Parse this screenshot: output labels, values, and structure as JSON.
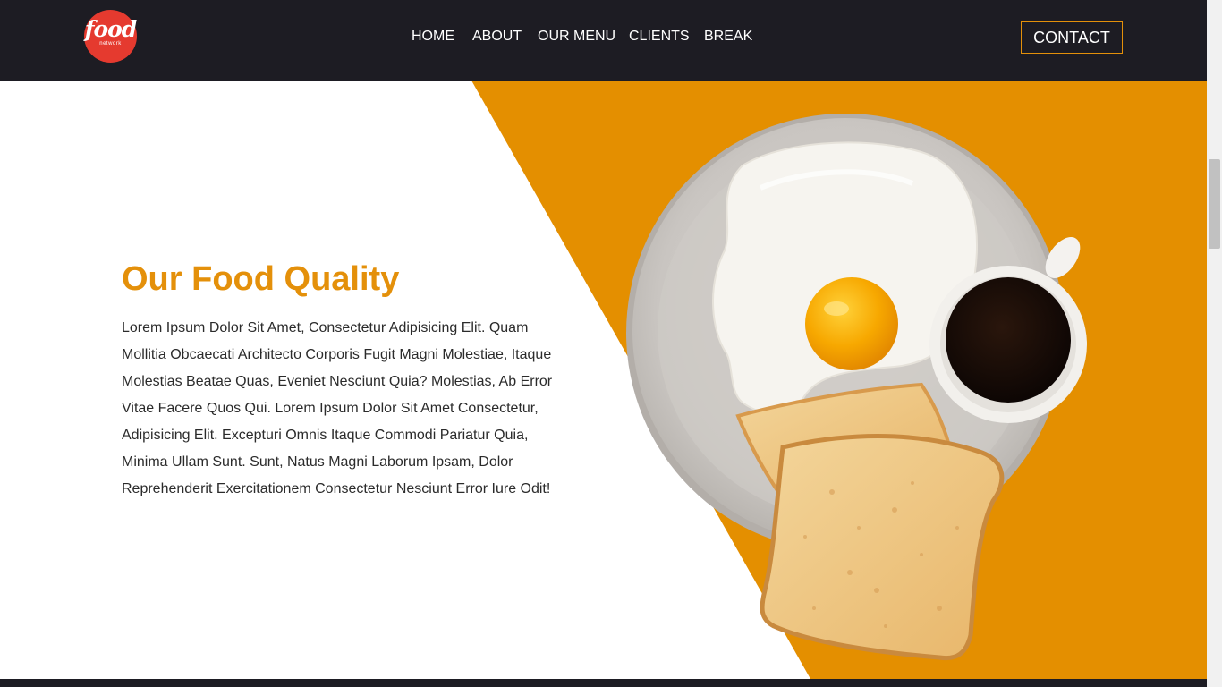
{
  "nav": {
    "logo_word": "food",
    "logo_sub": "network",
    "links": [
      "HOME",
      "ABOUT",
      "OUR MENU",
      "CLIENTS",
      "BREAK"
    ],
    "contact_label": "CONTACT"
  },
  "hero": {
    "title": "Our Food Quality",
    "body": "Lorem Ipsum Dolor Sit Amet, Consectetur Adipisicing Elit. Quam Mollitia Obcaecati Architecto Corporis Fugit Magni Molestiae, Itaque Molestias Beatae Quas, Eveniet Nesciunt Quia? Molestias, Ab Error Vitae Facere Quos Qui. Lorem Ipsum Dolor Sit Amet Consectetur, Adipisicing Elit. Excepturi Omnis Itaque Commodi Pariatur Quia, Minima Ullam Sunt. Sunt, Natus Magni Laborum Ipsam, Dolor Reprehenderit Exercitationem Consectetur Nesciunt Error Iure Odit!"
  },
  "colors": {
    "nav_bg": "#1d1c23",
    "accent": "#e4900a",
    "logo_red": "#e53a2f",
    "text": "#2b2b2b"
  },
  "icons": {
    "logo": "food-network-logo",
    "hero_image": "breakfast-plate-egg-toast-coffee"
  }
}
